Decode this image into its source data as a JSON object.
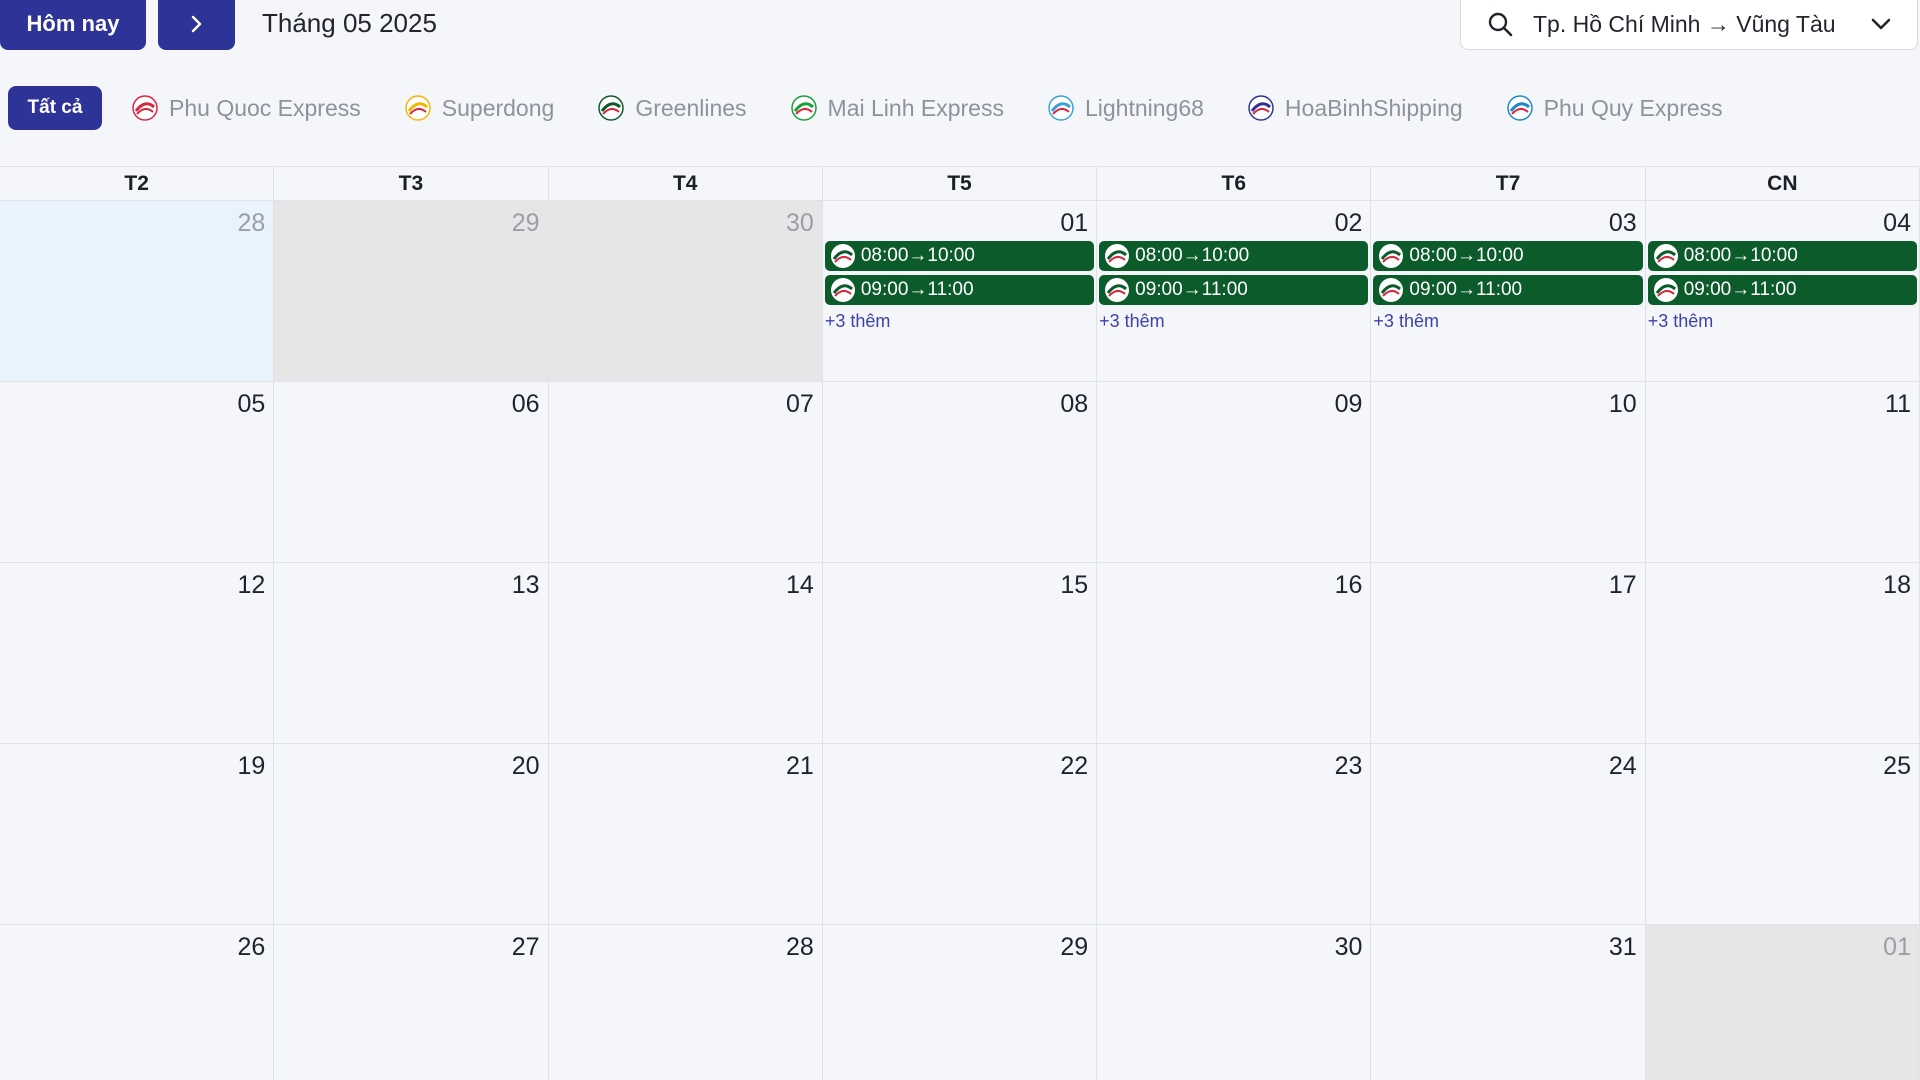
{
  "toolbar": {
    "today_label": "Hôm nay",
    "next_label": "›",
    "month_title": "Tháng 05 2025"
  },
  "route": {
    "text": "Tp. Hồ Chí Minh → Vũng Tàu"
  },
  "filters": {
    "all_label": "Tất cả",
    "operators": [
      {
        "name": "Phu Quoc Express",
        "icon": "phu-quoc-express-logo",
        "color": "#d7263d"
      },
      {
        "name": "Superdong",
        "icon": "superdong-logo",
        "color": "#f2b705"
      },
      {
        "name": "Greenlines",
        "icon": "greenlines-logo",
        "color": "#0b5b2b"
      },
      {
        "name": "Mai Linh Express",
        "icon": "mai-linh-logo",
        "color": "#1a9e3a"
      },
      {
        "name": "Lightning68",
        "icon": "lightning68-logo",
        "color": "#3aa0d8"
      },
      {
        "name": "HoaBinhShipping",
        "icon": "hoabinh-logo",
        "color": "#2e3497"
      },
      {
        "name": "Phu Quy Express",
        "icon": "phu-quy-logo",
        "color": "#1e88c8"
      }
    ]
  },
  "weekdays": [
    "T2",
    "T3",
    "T4",
    "T5",
    "T6",
    "T7",
    "CN"
  ],
  "weeks": [
    [
      {
        "day": "28",
        "state": "today"
      },
      {
        "day": "29",
        "state": "muted"
      },
      {
        "day": "30",
        "state": "muted"
      },
      {
        "day": "01",
        "state": "normal"
      },
      {
        "day": "02",
        "state": "normal"
      },
      {
        "day": "03",
        "state": "normal"
      },
      {
        "day": "04",
        "state": "normal"
      }
    ],
    [
      {
        "day": "05",
        "state": "normal"
      },
      {
        "day": "06",
        "state": "normal"
      },
      {
        "day": "07",
        "state": "normal"
      },
      {
        "day": "08",
        "state": "normal"
      },
      {
        "day": "09",
        "state": "normal"
      },
      {
        "day": "10",
        "state": "normal"
      },
      {
        "day": "11",
        "state": "normal"
      }
    ],
    [
      {
        "day": "12",
        "state": "normal"
      },
      {
        "day": "13",
        "state": "normal"
      },
      {
        "day": "14",
        "state": "normal"
      },
      {
        "day": "15",
        "state": "normal"
      },
      {
        "day": "16",
        "state": "normal"
      },
      {
        "day": "17",
        "state": "normal"
      },
      {
        "day": "18",
        "state": "normal"
      }
    ],
    [
      {
        "day": "19",
        "state": "normal"
      },
      {
        "day": "20",
        "state": "normal"
      },
      {
        "day": "21",
        "state": "normal"
      },
      {
        "day": "22",
        "state": "normal"
      },
      {
        "day": "23",
        "state": "normal"
      },
      {
        "day": "24",
        "state": "normal"
      },
      {
        "day": "25",
        "state": "normal"
      }
    ],
    [
      {
        "day": "26",
        "state": "normal"
      },
      {
        "day": "27",
        "state": "normal"
      },
      {
        "day": "28",
        "state": "normal"
      },
      {
        "day": "29",
        "state": "normal"
      },
      {
        "day": "30",
        "state": "normal"
      },
      {
        "day": "31",
        "state": "normal"
      },
      {
        "day": "01",
        "state": "muted"
      }
    ]
  ],
  "event_days": [
    "01",
    "02",
    "03",
    "04"
  ],
  "events": [
    {
      "time": "08:00→10:00",
      "operator_icon": "greenlines-logo"
    },
    {
      "time": "09:00→11:00",
      "operator_icon": "greenlines-logo"
    }
  ],
  "more_label": "+3 thêm",
  "colors": {
    "accent": "#2e3497",
    "event_bg": "#0b5b2b",
    "more_link": "#3c42a8",
    "muted_cell": "#e6e6e7",
    "today_cell": "#e8f3fc"
  }
}
